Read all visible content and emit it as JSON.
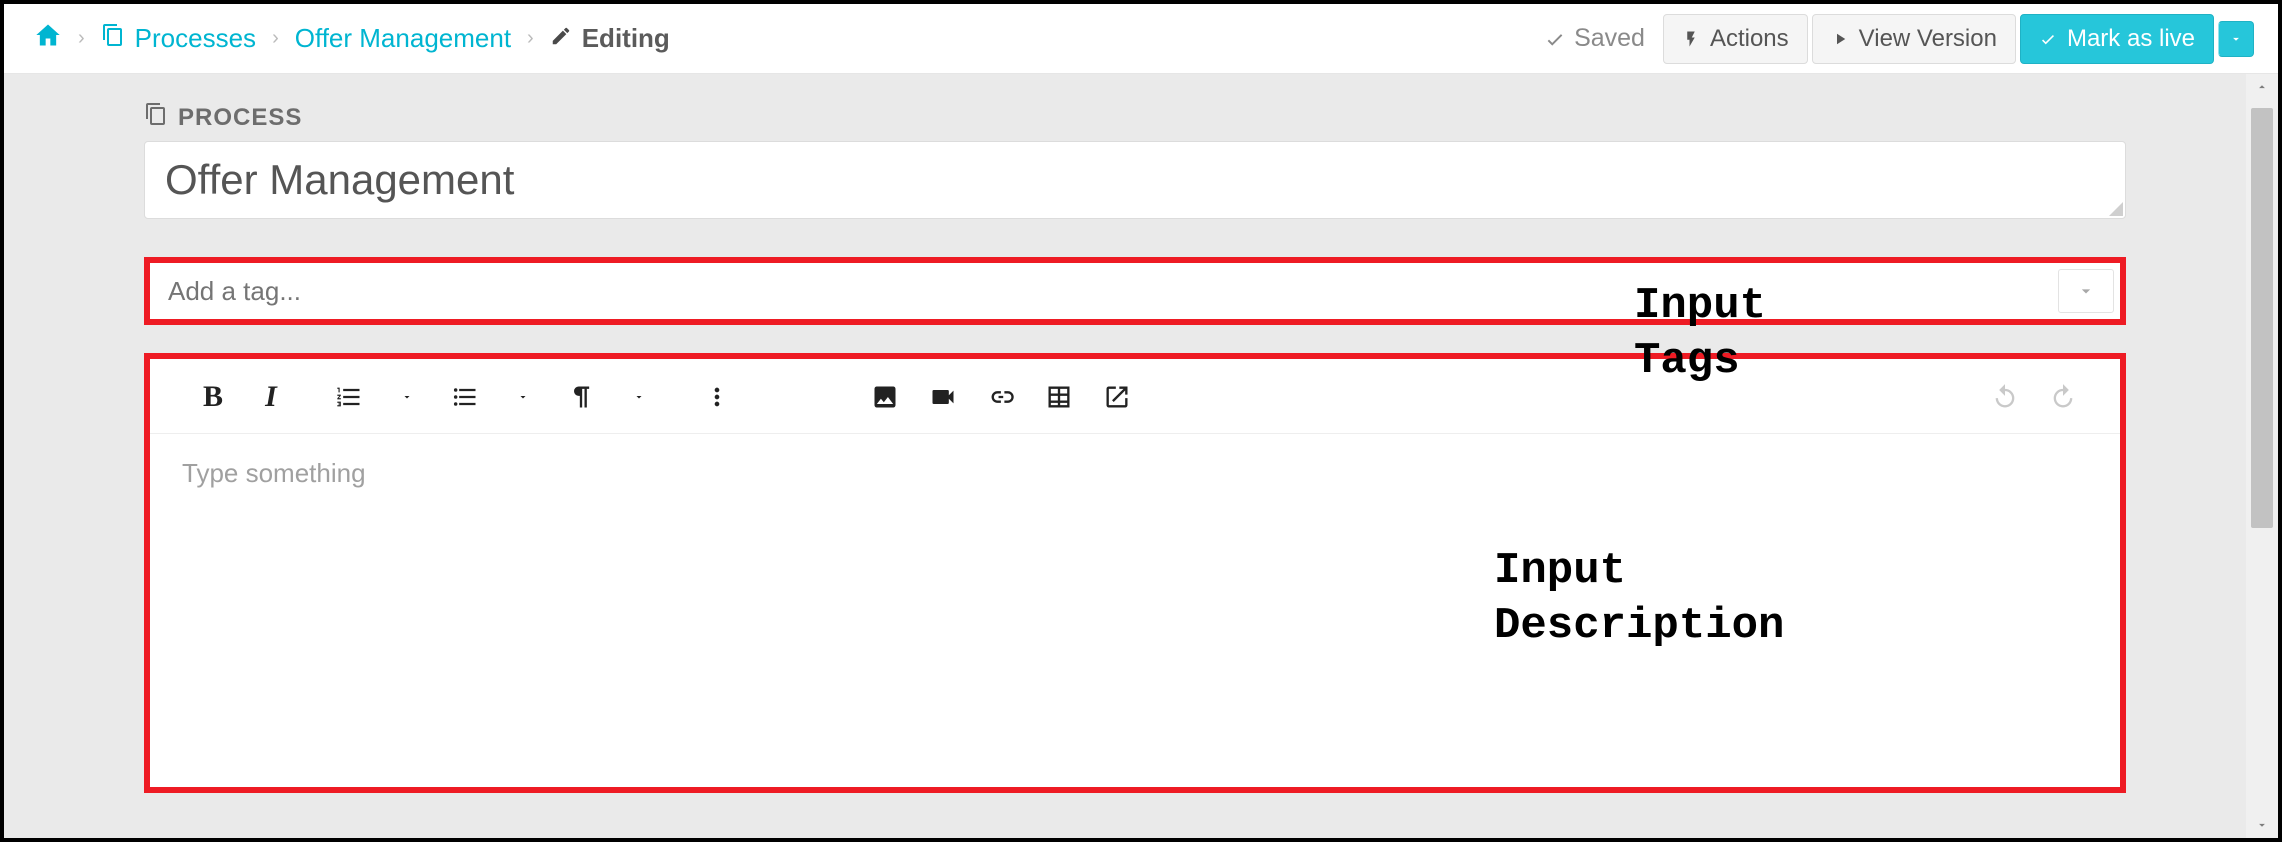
{
  "breadcrumb": {
    "processes_label": "Processes",
    "offer_mgmt_label": "Offer Management",
    "editing_label": "Editing"
  },
  "toolbar": {
    "saved_label": "Saved",
    "actions_label": "Actions",
    "view_version_label": "View Version",
    "mark_as_live_label": "Mark as live"
  },
  "section_label": "PROCESS",
  "title_value": "Offer Management",
  "tag_placeholder": "Add a tag...",
  "editor_placeholder": "Type something",
  "annotations": {
    "tags": "Input\nTags",
    "description": "Input\nDescription"
  }
}
